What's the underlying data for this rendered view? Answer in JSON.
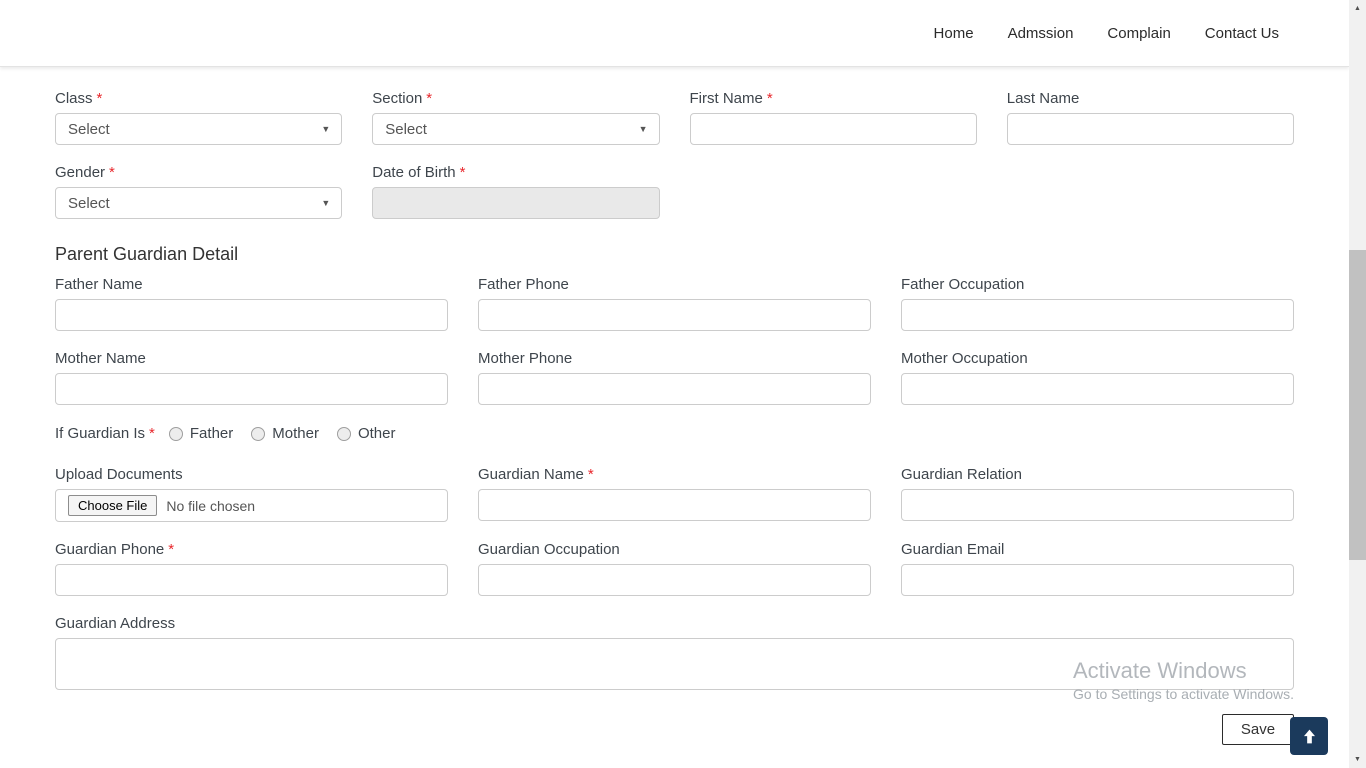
{
  "nav": {
    "items": [
      "Home",
      "Admssion",
      "Complain",
      "Contact Us"
    ]
  },
  "form": {
    "required_marker": "*",
    "select_placeholder": "Select",
    "student": {
      "class": {
        "label": "Class"
      },
      "section": {
        "label": "Section"
      },
      "first_name": {
        "label": "First Name"
      },
      "last_name": {
        "label": "Last Name"
      },
      "gender": {
        "label": "Gender"
      },
      "dob": {
        "label": "Date of Birth"
      }
    },
    "guardian_section": {
      "heading": "Parent Guardian Detail",
      "father_name": {
        "label": "Father Name"
      },
      "father_phone": {
        "label": "Father Phone"
      },
      "father_occupation": {
        "label": "Father Occupation"
      },
      "mother_name": {
        "label": "Mother Name"
      },
      "mother_phone": {
        "label": "Mother Phone"
      },
      "mother_occupation": {
        "label": "Mother Occupation"
      },
      "if_guardian_is": {
        "label": "If Guardian Is",
        "options": [
          "Father",
          "Mother",
          "Other"
        ]
      },
      "upload_documents": {
        "label": "Upload Documents",
        "button": "Choose File",
        "status": "No file chosen"
      },
      "guardian_name": {
        "label": "Guardian Name"
      },
      "guardian_relation": {
        "label": "Guardian Relation"
      },
      "guardian_phone": {
        "label": "Guardian Phone"
      },
      "guardian_occupation": {
        "label": "Guardian Occupation"
      },
      "guardian_email": {
        "label": "Guardian Email"
      },
      "guardian_address": {
        "label": "Guardian Address"
      }
    },
    "save_label": "Save"
  },
  "watermark": {
    "line1": "Activate Windows",
    "line2": "Go to Settings to activate Windows."
  },
  "colors": {
    "required": "#e8262b",
    "accent_dark": "#1b3a5c",
    "scrollbar_thumb": "#c1c1c1",
    "scrollbar_track": "#f1f1f1"
  }
}
